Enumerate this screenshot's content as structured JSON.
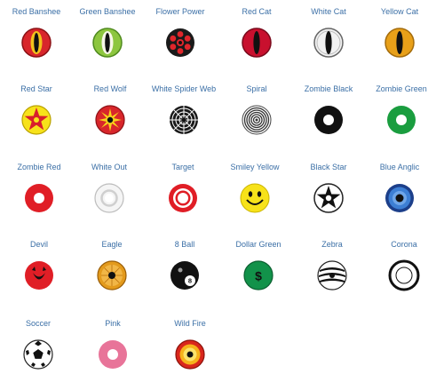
{
  "catalog": {
    "items": [
      {
        "id": "red-banshee",
        "label": "Red Banshee"
      },
      {
        "id": "green-banshee",
        "label": "Green Banshee"
      },
      {
        "id": "flower-power",
        "label": "Flower Power"
      },
      {
        "id": "red-cat",
        "label": "Red Cat"
      },
      {
        "id": "white-cat",
        "label": "White Cat"
      },
      {
        "id": "yellow-cat",
        "label": "Yellow Cat"
      },
      {
        "id": "red-star",
        "label": "Red Star"
      },
      {
        "id": "red-wolf",
        "label": "Red Wolf"
      },
      {
        "id": "white-spider-web",
        "label": "White Spider Web"
      },
      {
        "id": "spiral",
        "label": "Spiral"
      },
      {
        "id": "zombie-black",
        "label": "Zombie Black"
      },
      {
        "id": "zombie-green",
        "label": "Zombie Green"
      },
      {
        "id": "zombie-red",
        "label": "Zombie Red"
      },
      {
        "id": "white-out",
        "label": "White Out"
      },
      {
        "id": "target",
        "label": "Target"
      },
      {
        "id": "smiley-yellow",
        "label": "Smiley Yellow"
      },
      {
        "id": "black-star",
        "label": "Black Star"
      },
      {
        "id": "blue-anglic",
        "label": "Blue Anglic"
      },
      {
        "id": "devil",
        "label": "Devil"
      },
      {
        "id": "eagle",
        "label": "Eagle"
      },
      {
        "id": "8-ball",
        "label": "8 Ball"
      },
      {
        "id": "dollar-green",
        "label": "Dollar Green"
      },
      {
        "id": "zebra",
        "label": "Zebra"
      },
      {
        "id": "corona",
        "label": "Corona"
      },
      {
        "id": "soccer",
        "label": "Soccer"
      },
      {
        "id": "pink",
        "label": "Pink"
      },
      {
        "id": "wild-fire",
        "label": "Wild Fire"
      }
    ],
    "colors": {
      "label": "#3b6fa6",
      "background": "#ffffff"
    }
  }
}
